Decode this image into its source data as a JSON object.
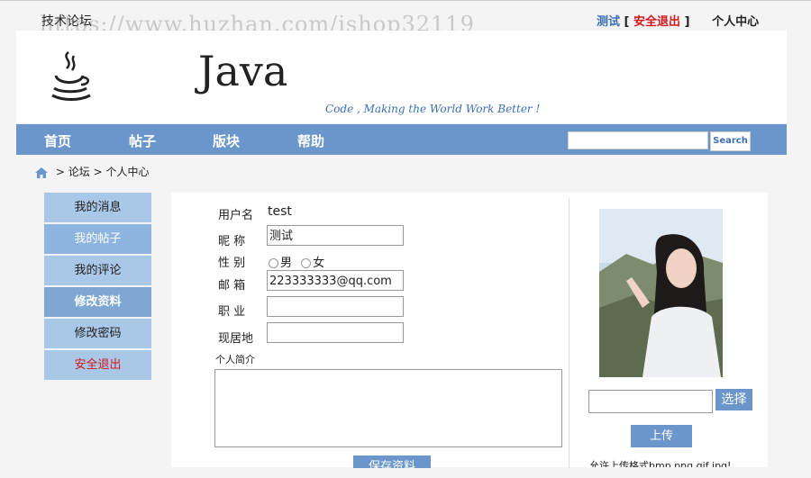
{
  "site_title": "技术论坛",
  "watermark": "https://www.huzhan.com/ishop32119",
  "user_area": {
    "username": "测试",
    "bracket_open": "[",
    "logout": "安全退出",
    "bracket_close": "]",
    "user_center": "个人中心"
  },
  "banner": {
    "java_text": "Java",
    "slogan": "Code , Making the World Work Better !"
  },
  "nav": {
    "items": [
      "首页",
      "帖子",
      "版块",
      "帮助"
    ],
    "search_button": "Search"
  },
  "breadcrumb": {
    "sep1": ">",
    "forum": "论坛",
    "sep2": ">",
    "current": "个人中心"
  },
  "sidebar": {
    "items": [
      "我的消息",
      "我的帖子",
      "我的评论",
      "修改资料",
      "修改密码",
      "安全退出"
    ]
  },
  "profile_form": {
    "username_label": "用户名",
    "username_value": "test",
    "nickname_label": "昵  称",
    "nickname_value": "测试",
    "gender_label": "性  别",
    "gender_options": [
      "男",
      "女"
    ],
    "email_label": "邮  箱",
    "email_value": "223333333@qq.com",
    "job_label": "职  业",
    "job_value": "",
    "location_label": "现居地",
    "location_value": "",
    "bio_label": "个人简介",
    "bio_value": "",
    "save_button": "保存资料"
  },
  "avatar_panel": {
    "choose_button": "选择",
    "upload_button": "上传",
    "hint": "允许上传格式bmp,png,gif,jpg!"
  },
  "colors": {
    "accent": "#6b96cb",
    "sidebar": "#a9c7e6",
    "logout_red": "#d3161c"
  }
}
